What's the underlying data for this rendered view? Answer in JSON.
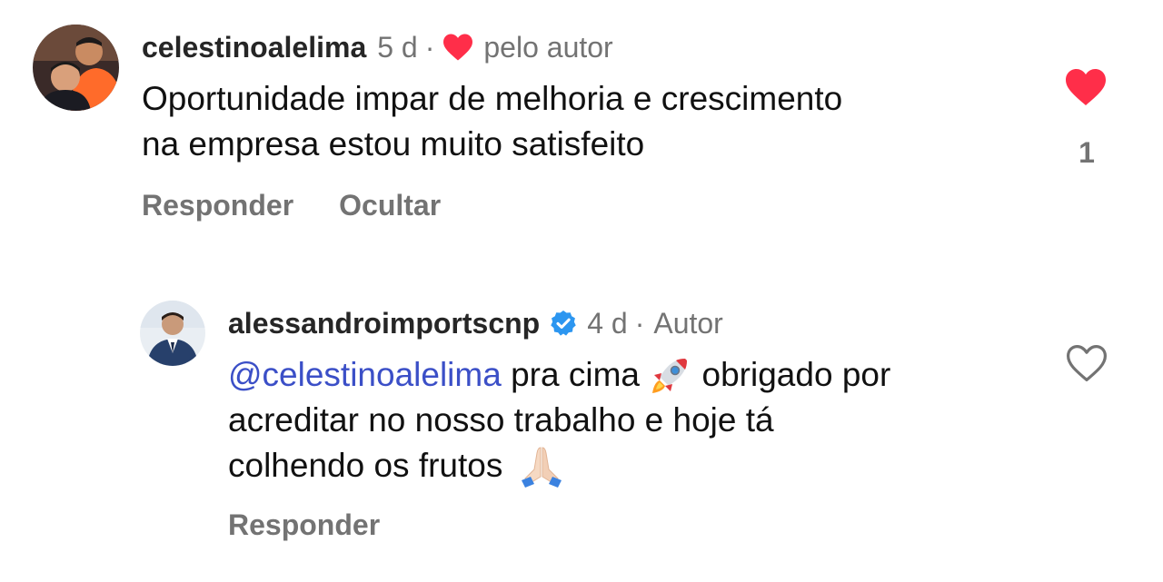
{
  "comments": [
    {
      "username": "celestinoalelima",
      "time": "5 d",
      "dot": "·",
      "liked_by_label": "pelo autor",
      "text_line1": "Oportunidade impar de melhoria e crescimento",
      "text_line2": "na empresa estou muito satisfeito",
      "actions": {
        "reply": "Responder",
        "hide": "Ocultar"
      },
      "like_count": "1",
      "liked": true,
      "icons": {
        "author_like": "heart-icon",
        "like": "heart-filled-icon"
      }
    },
    {
      "username": "alessandroimportscnp",
      "verified": true,
      "time": "4 d",
      "dot": "·",
      "author_label": "Autor",
      "mention": "@celestinoalelima",
      "text_part1": " pra cima ",
      "text_part2": " obrigado por",
      "text_line2": "acreditar no nosso trabalho e hoje tá",
      "text_line3": "colhendo os frutos ",
      "actions": {
        "reply": "Responder"
      },
      "liked": false,
      "icons": {
        "verified": "verified-badge-icon",
        "rocket": "rocket-emoji",
        "pray": "folded-hands-emoji",
        "like": "heart-outline-icon"
      }
    }
  ],
  "colors": {
    "heart": "#ff2e49",
    "mention": "#3b4fc7",
    "verified": "#2c96f0",
    "muted": "#737373"
  }
}
